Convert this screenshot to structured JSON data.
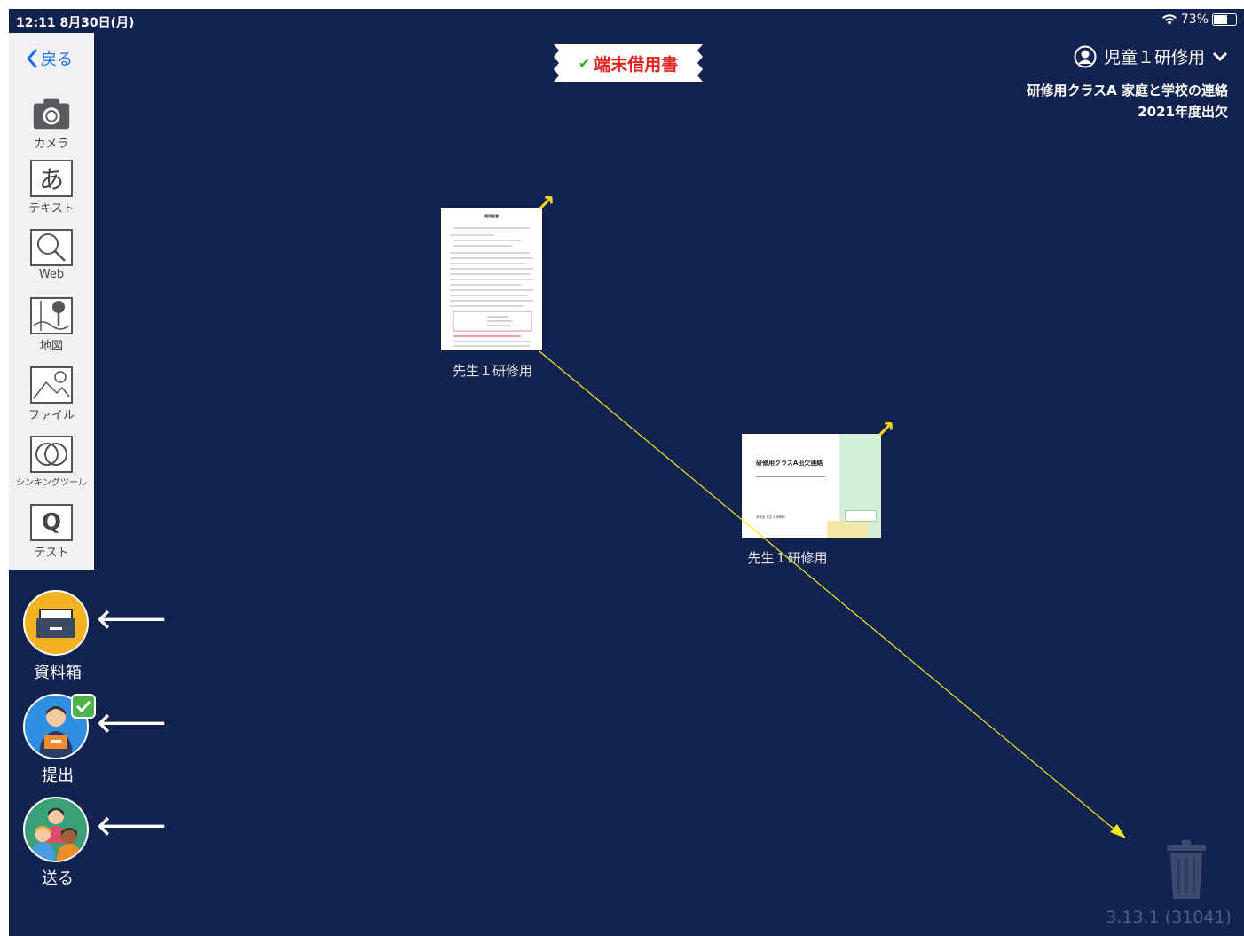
{
  "status_bar": {
    "time": "12:11  8月30日(月)",
    "battery": "73%",
    "battery_level": 0.73
  },
  "toolbar": {
    "back_label": "戻る",
    "tools": [
      {
        "label": "カメラ",
        "icon": "camera-icon"
      },
      {
        "label": "テキスト",
        "icon": "text-icon"
      },
      {
        "label": "Web",
        "icon": "web-search-icon"
      },
      {
        "label": "地図",
        "icon": "map-icon"
      },
      {
        "label": "ファイル",
        "icon": "image-file-icon"
      },
      {
        "label": "シンキングツール",
        "icon": "thinking-tool-icon"
      },
      {
        "label": "テスト",
        "icon": "test-icon"
      }
    ],
    "test_glyph": "Q",
    "text_glyph": "あ"
  },
  "side_actions": [
    {
      "label": "資料箱",
      "icon": "material-box-icon"
    },
    {
      "label": "提出",
      "icon": "submit-icon"
    },
    {
      "label": "送る",
      "icon": "send-icon"
    }
  ],
  "title": {
    "text": "端末借用書",
    "check": "✔"
  },
  "user": {
    "name": "児童１研修用"
  },
  "class_info": {
    "line1": "研修用クラスA 家庭と学校の連絡",
    "line2": "2021年度出欠"
  },
  "cards": [
    {
      "caption": "先生１研修用",
      "doc_title": "借用証書"
    },
    {
      "caption": "先生１研修用",
      "doc_title": "研修用クラスA出欠連絡",
      "doc_footer": "学校名 先生１研修用"
    }
  ],
  "version": "3.13.1 (31041)",
  "colors": {
    "background": "#132350",
    "accent": "#1a6fe8",
    "highlight": "#f5d21a",
    "title_red": "#e0231f"
  }
}
